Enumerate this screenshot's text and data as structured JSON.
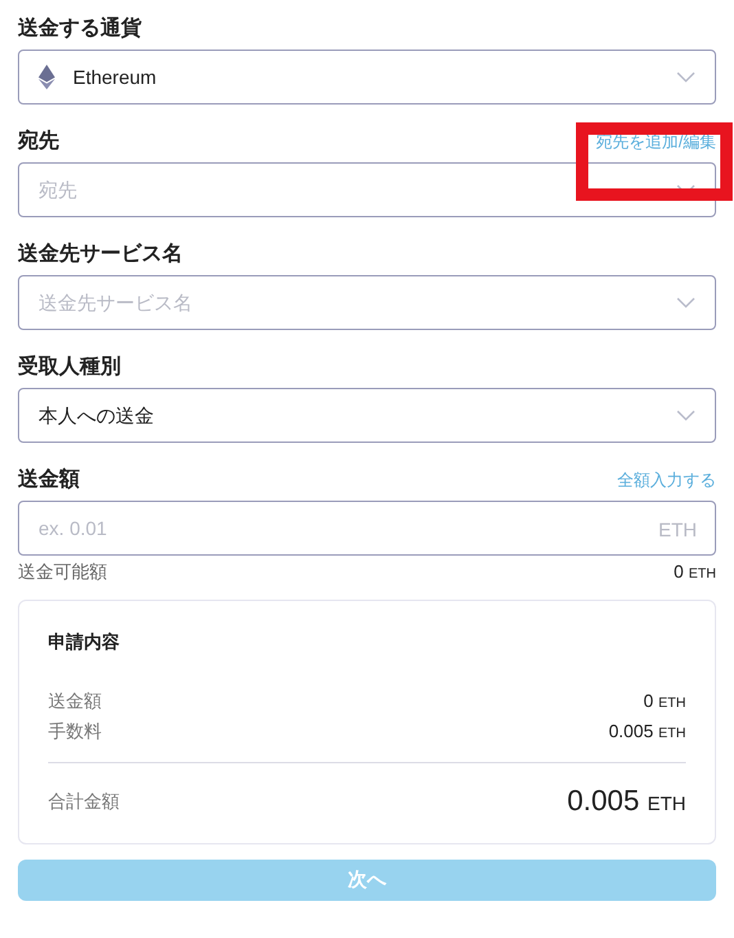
{
  "fields": [
    {
      "kind": "select",
      "label": "送金する通貨",
      "value": "Ethereum",
      "coin_icon": true
    },
    {
      "kind": "select",
      "label": "宛先",
      "placeholder": "宛先",
      "link": "宛先を追加/編集",
      "highlighted": true
    },
    {
      "kind": "select",
      "label": "送金先サービス名",
      "placeholder": "送金先サービス名"
    },
    {
      "kind": "select",
      "label": "受取人種別",
      "value": "本人への送金"
    },
    {
      "kind": "amount",
      "label": "送金額",
      "link": "全額入力する",
      "placeholder": "ex. 0.01",
      "unit": "ETH",
      "available_label": "送金可能額",
      "available_value": "0",
      "available_unit": "ETH"
    }
  ],
  "summary": {
    "title": "申請内容",
    "rows": [
      {
        "label": "送金額",
        "value": "0",
        "unit": "ETH"
      },
      {
        "label": "手数料",
        "value": "0.005",
        "unit": "ETH"
      }
    ],
    "total": {
      "label": "合計金額",
      "value": "0.005",
      "unit": "ETH"
    }
  },
  "next_button": {
    "label": "次へ",
    "disabled": true
  }
}
